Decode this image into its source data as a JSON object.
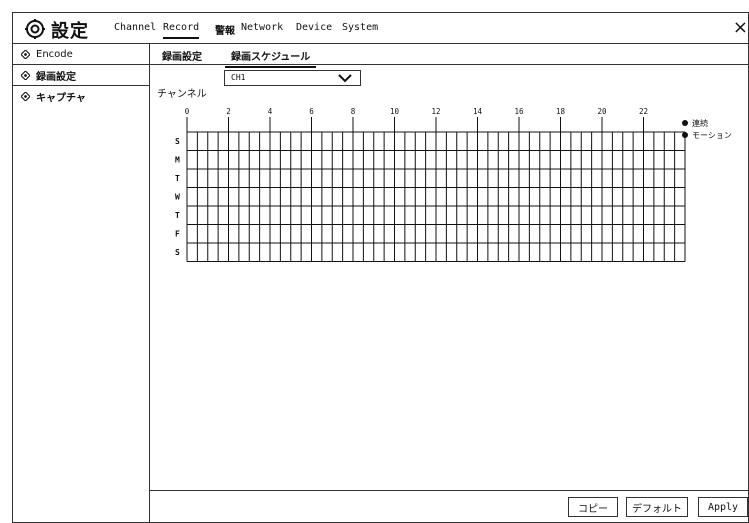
{
  "header": {
    "title": "設定",
    "menu": [
      {
        "label": "Channel"
      },
      {
        "label": "Record",
        "active": true
      },
      {
        "label": "警報"
      },
      {
        "label": "Network"
      },
      {
        "label": "Device"
      },
      {
        "label": "System"
      }
    ],
    "close": "×"
  },
  "sidebar": {
    "items": [
      {
        "label": "Encode"
      },
      {
        "label": "録画設定",
        "active": true
      },
      {
        "label": "キャプチャ"
      }
    ]
  },
  "tabs": [
    {
      "label": "録画設定"
    },
    {
      "label": "録画スケジュール",
      "active": true
    }
  ],
  "channel": {
    "label": "チャンネル",
    "value": "CH1"
  },
  "schedule": {
    "hours": [
      "0",
      "2",
      "4",
      "6",
      "8",
      "10",
      "12",
      "14",
      "16",
      "18",
      "20",
      "22"
    ],
    "days": [
      "S",
      "M",
      "T",
      "W",
      "T",
      "F",
      "S"
    ]
  },
  "legend": [
    {
      "label": "連続",
      "color": "#111111"
    },
    {
      "label": "モーション",
      "color": "#111111"
    }
  ],
  "buttons": {
    "copy": "コピー",
    "default": "デフォルト",
    "apply": "Apply"
  }
}
